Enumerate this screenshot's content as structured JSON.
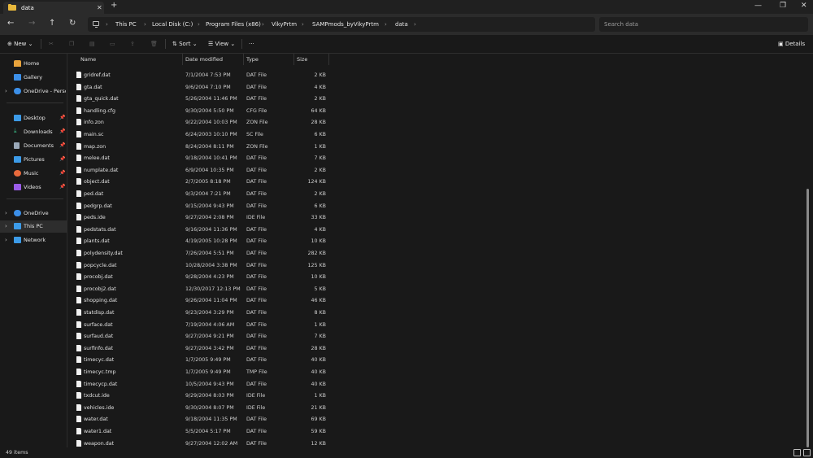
{
  "window": {
    "tab_title": "data"
  },
  "address": {
    "crumbs": [
      "This PC",
      "Local Disk (C:)",
      "Program Files (x86)",
      "VikyPrtm",
      "SAMPmods_byVikyPrtm",
      "data"
    ],
    "search_placeholder": "Search data"
  },
  "toolbar": {
    "new_label": "New",
    "sort_label": "Sort",
    "view_label": "View",
    "more_label": "···",
    "details_label": "Details"
  },
  "sidebar": {
    "items": [
      {
        "label": "Home",
        "icon": "home-icon",
        "color": "#e8a33c"
      },
      {
        "label": "Gallery",
        "icon": "gallery-icon",
        "color": "#3c8fe8"
      },
      {
        "label": "OneDrive - Persona",
        "icon": "cloud-icon",
        "color": "#3c8fe8"
      },
      {
        "label": "Desktop",
        "icon": "desktop-icon",
        "color": "#3c9be8"
      },
      {
        "label": "Downloads",
        "icon": "download-icon",
        "color": "#3cc08a"
      },
      {
        "label": "Documents",
        "icon": "documents-icon",
        "color": "#9aa8b8"
      },
      {
        "label": "Pictures",
        "icon": "pictures-icon",
        "color": "#3c9be8"
      },
      {
        "label": "Music",
        "icon": "music-icon",
        "color": "#e86a3c"
      },
      {
        "label": "Videos",
        "icon": "videos-icon",
        "color": "#9a5ce8"
      },
      {
        "label": "OneDrive",
        "icon": "cloud-icon",
        "color": "#3c8fe8"
      },
      {
        "label": "This PC",
        "icon": "pc-icon",
        "color": "#3c9be8"
      },
      {
        "label": "Network",
        "icon": "network-icon",
        "color": "#3c9be8"
      }
    ]
  },
  "columns": {
    "name": "Name",
    "date": "Date modified",
    "type": "Type",
    "size": "Size"
  },
  "files": [
    {
      "name": "gridref.dat",
      "date": "7/1/2004 7:53 PM",
      "type": "DAT File",
      "size": "2 KB"
    },
    {
      "name": "gta.dat",
      "date": "9/6/2004 7:10 PM",
      "type": "DAT File",
      "size": "4 KB"
    },
    {
      "name": "gta_quick.dat",
      "date": "5/26/2004 11:46 PM",
      "type": "DAT File",
      "size": "2 KB"
    },
    {
      "name": "handling.cfg",
      "date": "9/30/2004 5:50 PM",
      "type": "CFG File",
      "size": "64 KB"
    },
    {
      "name": "info.zon",
      "date": "9/22/2004 10:03 PM",
      "type": "ZON File",
      "size": "28 KB"
    },
    {
      "name": "main.sc",
      "date": "6/24/2003 10:10 PM",
      "type": "SC File",
      "size": "6 KB"
    },
    {
      "name": "map.zon",
      "date": "8/24/2004 8:11 PM",
      "type": "ZON File",
      "size": "1 KB"
    },
    {
      "name": "melee.dat",
      "date": "9/18/2004 10:41 PM",
      "type": "DAT File",
      "size": "7 KB"
    },
    {
      "name": "numplate.dat",
      "date": "6/9/2004 10:35 PM",
      "type": "DAT File",
      "size": "2 KB"
    },
    {
      "name": "object.dat",
      "date": "2/7/2005 8:18 PM",
      "type": "DAT File",
      "size": "124 KB"
    },
    {
      "name": "ped.dat",
      "date": "9/3/2004 7:21 PM",
      "type": "DAT File",
      "size": "2 KB"
    },
    {
      "name": "pedgrp.dat",
      "date": "9/15/2004 9:43 PM",
      "type": "DAT File",
      "size": "6 KB"
    },
    {
      "name": "peds.ide",
      "date": "9/27/2004 2:08 PM",
      "type": "IDE File",
      "size": "33 KB"
    },
    {
      "name": "pedstats.dat",
      "date": "9/16/2004 11:36 PM",
      "type": "DAT File",
      "size": "4 KB"
    },
    {
      "name": "plants.dat",
      "date": "4/19/2005 10:28 PM",
      "type": "DAT File",
      "size": "10 KB"
    },
    {
      "name": "polydensity.dat",
      "date": "7/26/2004 5:51 PM",
      "type": "DAT File",
      "size": "282 KB"
    },
    {
      "name": "popcycle.dat",
      "date": "10/28/2004 3:38 PM",
      "type": "DAT File",
      "size": "125 KB"
    },
    {
      "name": "procobj.dat",
      "date": "9/28/2004 4:23 PM",
      "type": "DAT File",
      "size": "10 KB"
    },
    {
      "name": "procobj2.dat",
      "date": "12/30/2017 12:13 PM",
      "type": "DAT File",
      "size": "5 KB"
    },
    {
      "name": "shopping.dat",
      "date": "9/26/2004 11:04 PM",
      "type": "DAT File",
      "size": "46 KB"
    },
    {
      "name": "statdisp.dat",
      "date": "9/23/2004 3:29 PM",
      "type": "DAT File",
      "size": "8 KB"
    },
    {
      "name": "surface.dat",
      "date": "7/19/2004 4:06 AM",
      "type": "DAT File",
      "size": "1 KB"
    },
    {
      "name": "surfaud.dat",
      "date": "9/27/2004 9:21 PM",
      "type": "DAT File",
      "size": "7 KB"
    },
    {
      "name": "surfinfo.dat",
      "date": "9/27/2004 3:42 PM",
      "type": "DAT File",
      "size": "28 KB"
    },
    {
      "name": "timecyc.dat",
      "date": "1/7/2005 9:49 PM",
      "type": "DAT File",
      "size": "40 KB"
    },
    {
      "name": "timecyc.tmp",
      "date": "1/7/2005 9:49 PM",
      "type": "TMP File",
      "size": "40 KB"
    },
    {
      "name": "timecycp.dat",
      "date": "10/5/2004 9:43 PM",
      "type": "DAT File",
      "size": "40 KB"
    },
    {
      "name": "txdcut.ide",
      "date": "9/29/2004 8:03 PM",
      "type": "IDE File",
      "size": "1 KB"
    },
    {
      "name": "vehicles.ide",
      "date": "9/30/2004 8:07 PM",
      "type": "IDE File",
      "size": "21 KB"
    },
    {
      "name": "water.dat",
      "date": "9/18/2004 11:35 PM",
      "type": "DAT File",
      "size": "69 KB"
    },
    {
      "name": "water1.dat",
      "date": "5/5/2004 5:17 PM",
      "type": "DAT File",
      "size": "59 KB"
    },
    {
      "name": "weapon.dat",
      "date": "9/27/2004 12:02 AM",
      "type": "DAT File",
      "size": "12 KB"
    }
  ],
  "status": {
    "item_count": "49 items"
  }
}
